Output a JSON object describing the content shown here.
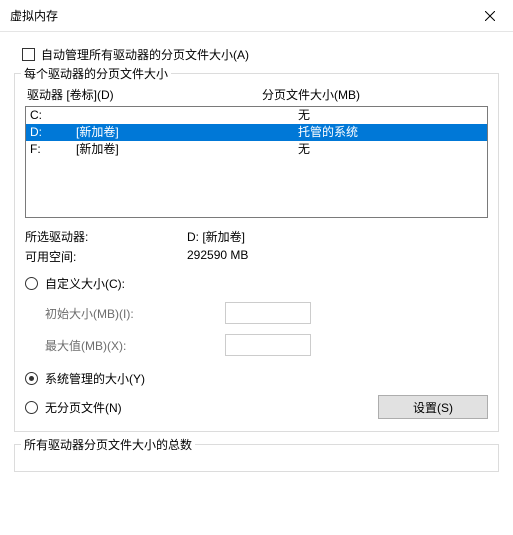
{
  "title": "虚拟内存",
  "auto_manage": "自动管理所有驱动器的分页文件大小(A)",
  "group1_label": "每个驱动器的分页文件大小",
  "headers": {
    "drive": "驱动器 [卷标](D)",
    "size": "分页文件大小(MB)"
  },
  "drives": [
    {
      "letter": "C:",
      "label": "",
      "size": "无"
    },
    {
      "letter": "D:",
      "label": "[新加卷]",
      "size": "托管的系统"
    },
    {
      "letter": "F:",
      "label": "[新加卷]",
      "size": "无"
    }
  ],
  "selected_drive_label": "所选驱动器:",
  "selected_drive_value": "D:  [新加卷]",
  "avail_label": "可用空间:",
  "avail_value": "292590 MB",
  "custom_size": "自定义大小(C):",
  "initial_size": "初始大小(MB)(I):",
  "max_size": "最大值(MB)(X):",
  "system_managed": "系统管理的大小(Y)",
  "no_paging": "无分页文件(N)",
  "set_btn": "设置(S)",
  "group2_label": "所有驱动器分页文件大小的总数"
}
